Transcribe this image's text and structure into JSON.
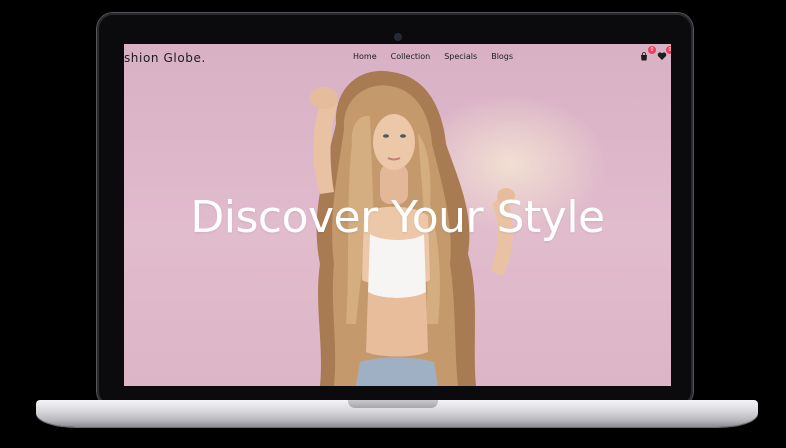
{
  "site": {
    "logo": "ashion Globe.",
    "nav": [
      "Home",
      "Collection",
      "Specials",
      "Blogs"
    ],
    "cart_count": "0",
    "wishlist_count": "0",
    "headline": "Discover Your Style"
  },
  "icons": [
    "bag-icon",
    "heart-icon"
  ],
  "colors": {
    "background": "#000000",
    "hero_pink": "#dcb3c5",
    "headline": "#ffffff",
    "badge": "#ef3d5a",
    "laptop_silver": "#d9d9dd"
  }
}
